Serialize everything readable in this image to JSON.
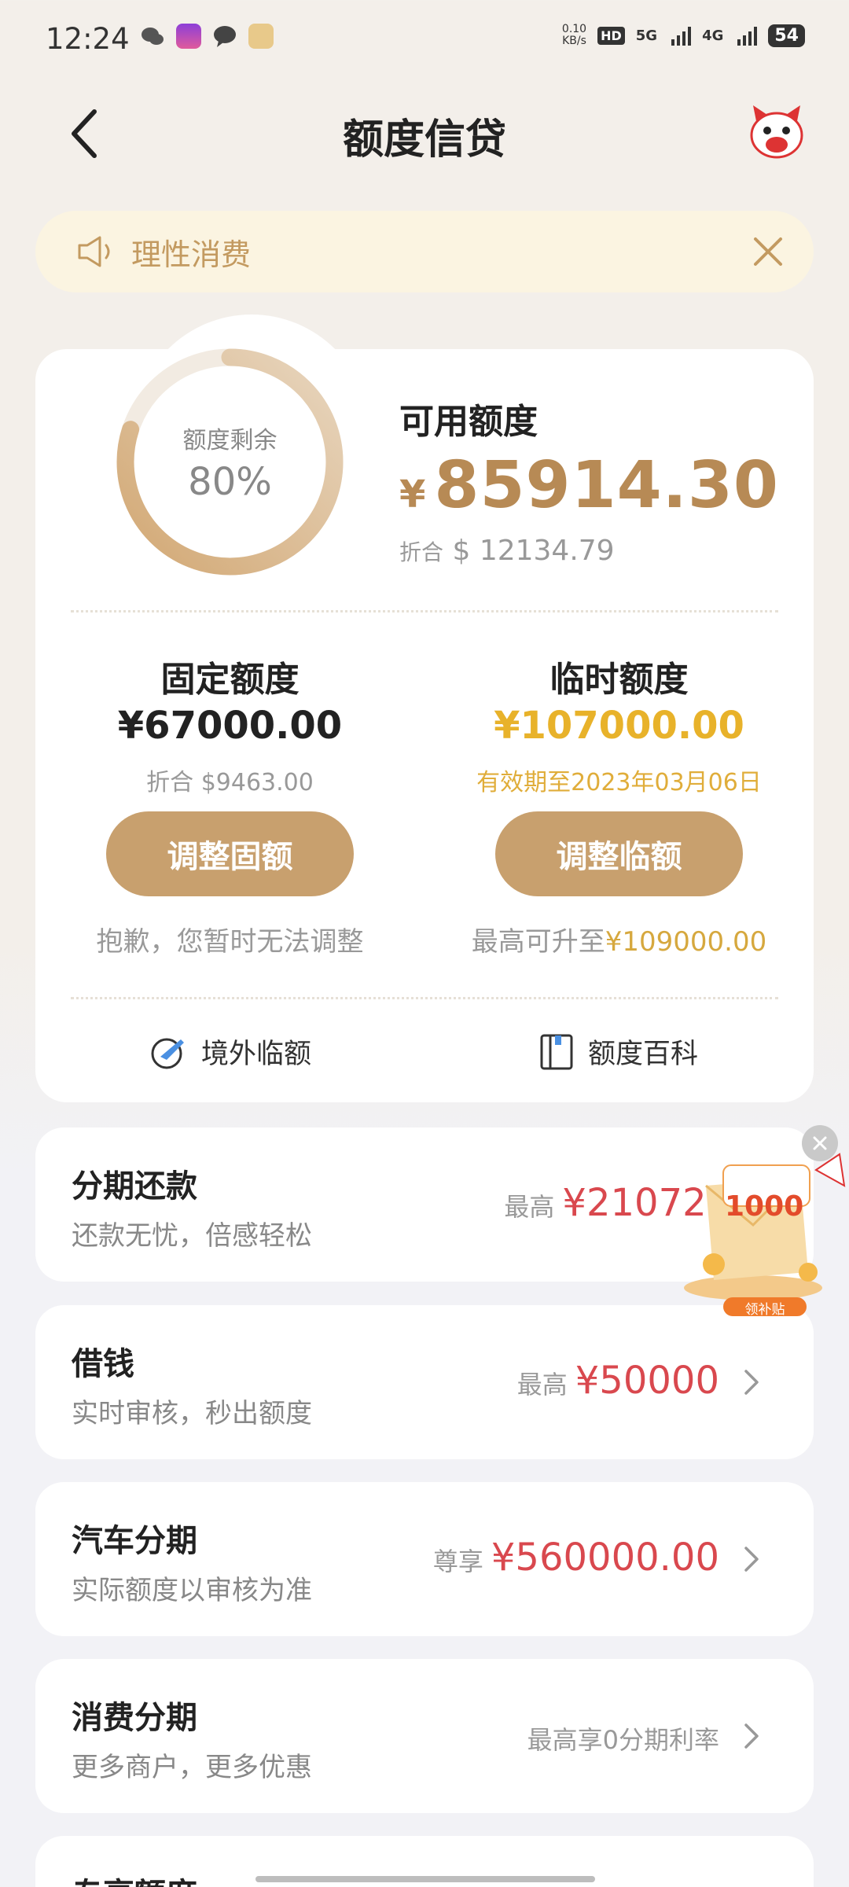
{
  "status_bar": {
    "time": "12:24",
    "speed_value": "0.10",
    "speed_unit": "KB/s",
    "hd": "HD",
    "sim1": "5G",
    "sim2": "4G",
    "battery": "54"
  },
  "nav": {
    "title": "额度信贷"
  },
  "notice": {
    "text": "理性消费"
  },
  "quota": {
    "ring_label": "额度剩余",
    "ring_value": "80%",
    "ring_fraction": 0.8,
    "available_label": "可用额度",
    "currency_symbol": "¥",
    "available_amount": "85914.30",
    "usd_prefix": "折合",
    "usd_amount": "$ 12134.79"
  },
  "fixed": {
    "title": "固定额度",
    "amount": "¥67000.00",
    "sub": "折合 $9463.00",
    "button": "调整固额",
    "note": "抱歉，您暂时无法调整"
  },
  "temp": {
    "title": "临时额度",
    "amount": "¥107000.00",
    "sub": "有效期至2023年03月06日",
    "button": "调整临额",
    "note_prefix": "最高可升至",
    "note_value": "¥109000.00"
  },
  "links": {
    "overseas": "境外临额",
    "wiki": "额度百科"
  },
  "list": [
    {
      "title": "分期还款",
      "sub": "还款无忧，倍感轻松",
      "pre": "最高",
      "value": "¥21072.00"
    },
    {
      "title": "借钱",
      "sub": "实时审核，秒出额度",
      "pre": "最高",
      "value": "¥50000"
    },
    {
      "title": "汽车分期",
      "sub": "实际额度以审核为准",
      "pre": "尊享",
      "value": "¥560000.00"
    },
    {
      "title": "消费分期",
      "sub": "更多商户，更多优惠",
      "pre": "最高享0分期利率",
      "value": ""
    },
    {
      "title": "专享额度"
    }
  ],
  "promo": {
    "amount": "1000",
    "label": "领补贴"
  },
  "colors": {
    "gold": "#c8a06e",
    "red": "#d9484e",
    "temp_gold": "#e8b22a"
  }
}
